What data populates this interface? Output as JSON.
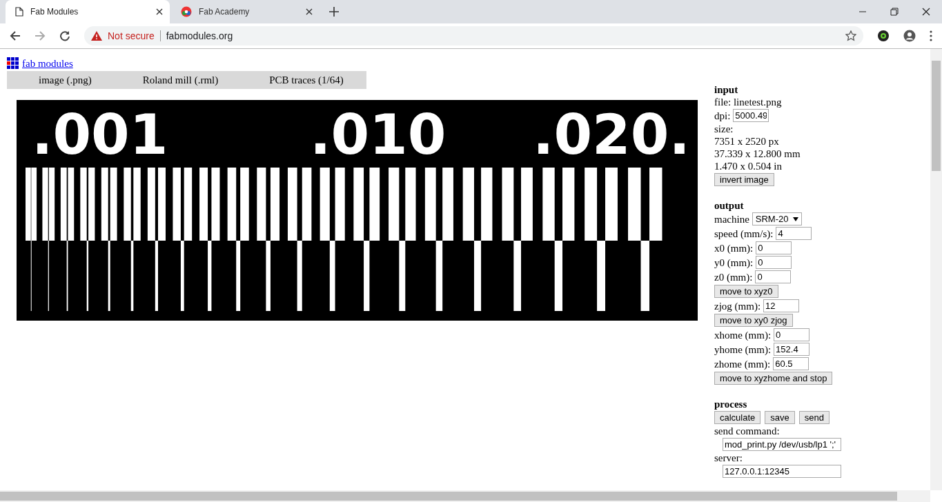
{
  "browser": {
    "tabs": [
      {
        "title": "Fab Modules",
        "kind": "page",
        "selected": true
      },
      {
        "title": "Fab Academy",
        "kind": "site",
        "selected": false
      }
    ],
    "address": {
      "security": "Not secure",
      "url": "fabmodules.org"
    }
  },
  "page": {
    "logo_link": "fab modules",
    "menu": [
      "image (.png)",
      "Roland mill (.rml)",
      "PCB traces (1/64)"
    ],
    "image": {
      "labels": [
        ".001",
        ".010",
        ".020."
      ]
    },
    "panel": [
      {
        "kind": "heading",
        "text": "input"
      },
      {
        "kind": "text",
        "text": "file: linetest.png"
      },
      {
        "kind": "field",
        "label": "dpi:",
        "value": "5000.49"
      },
      {
        "kind": "text",
        "text": "size:"
      },
      {
        "kind": "text",
        "text": "7351 x 2520 px"
      },
      {
        "kind": "text",
        "text": "37.339 x 12.800 mm"
      },
      {
        "kind": "text",
        "text": "1.470 x 0.504 in"
      },
      {
        "kind": "buttons",
        "labels": [
          "invert image"
        ]
      },
      {
        "kind": "gap"
      },
      {
        "kind": "heading",
        "text": "output"
      },
      {
        "kind": "select",
        "label": "machine",
        "value": "SRM-20"
      },
      {
        "kind": "field",
        "label": "speed (mm/s):",
        "value": "4"
      },
      {
        "kind": "field",
        "label": "x0 (mm):",
        "value": "0"
      },
      {
        "kind": "field",
        "label": "y0 (mm):",
        "value": "0"
      },
      {
        "kind": "field",
        "label": "z0 (mm):",
        "value": "0"
      },
      {
        "kind": "buttons",
        "labels": [
          "move to xyz0"
        ]
      },
      {
        "kind": "field",
        "label": "zjog (mm):",
        "value": "12"
      },
      {
        "kind": "buttons",
        "labels": [
          "move to xy0 zjog"
        ]
      },
      {
        "kind": "field",
        "label": "xhome (mm):",
        "value": "0"
      },
      {
        "kind": "field",
        "label": "yhome (mm):",
        "value": "152.4"
      },
      {
        "kind": "field",
        "label": "zhome (mm):",
        "value": "60.5"
      },
      {
        "kind": "buttons",
        "labels": [
          "move to xyzhome and stop"
        ]
      },
      {
        "kind": "gap"
      },
      {
        "kind": "heading",
        "text": "process"
      },
      {
        "kind": "buttons",
        "labels": [
          "calculate",
          "save",
          "send"
        ]
      },
      {
        "kind": "text",
        "text": "send command:"
      },
      {
        "kind": "wide_field",
        "value": "mod_print.py /dev/usb/lp1 ';'"
      },
      {
        "kind": "text",
        "text": "server:"
      },
      {
        "kind": "wide_field",
        "value": "127.0.0.1:12345"
      }
    ]
  }
}
